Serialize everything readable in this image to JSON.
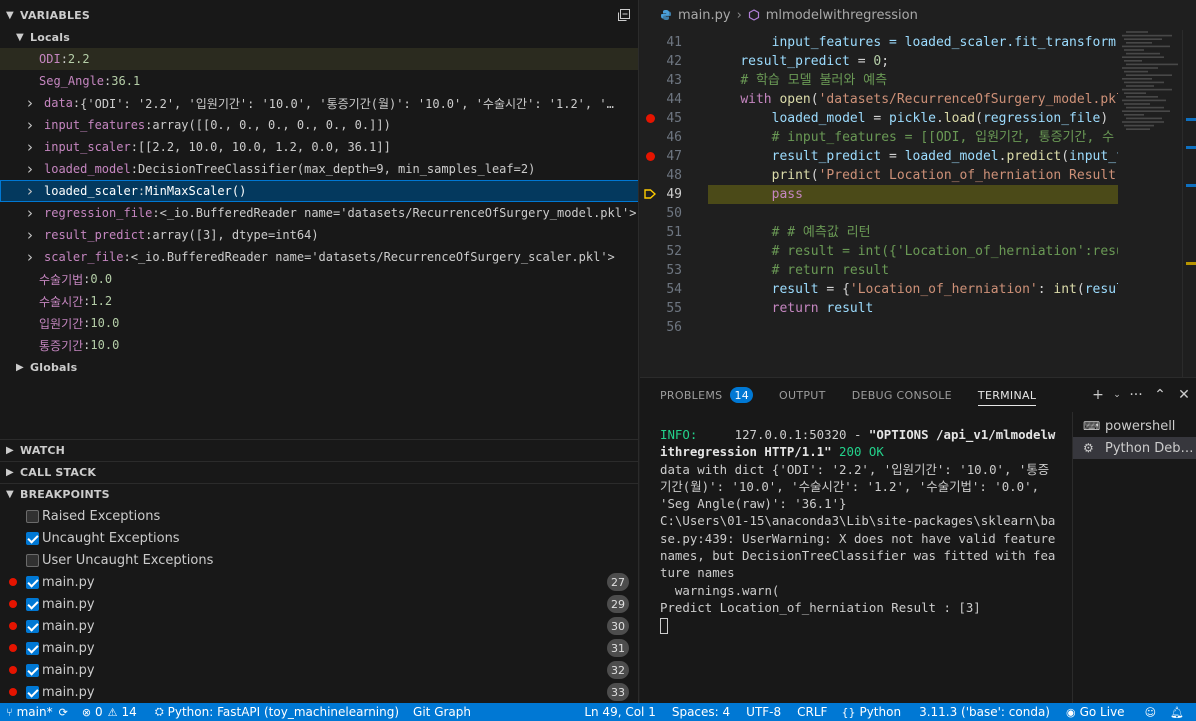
{
  "sidebar": {
    "variables_title": "VARIABLES",
    "locals_title": "Locals",
    "globals_title": "Globals",
    "watch_title": "WATCH",
    "callstack_title": "CALL STACK",
    "breakpoints_title": "BREAKPOINTS",
    "variables": [
      {
        "name": "ODI",
        "value": "2.2",
        "expandable": false,
        "changed": true
      },
      {
        "name": "Seg_Angle",
        "value": "36.1",
        "expandable": false,
        "changed": false
      },
      {
        "name": "data",
        "value": "{'ODI': '2.2', '입원기간': '10.0', '통증기간(월)': '10.0', '수술시간': '1.2', '…",
        "expandable": true
      },
      {
        "name": "input_features",
        "value": "array([[0., 0., 0., 0., 0., 0.]])",
        "expandable": true
      },
      {
        "name": "input_scaler",
        "value": "[[2.2, 10.0, 10.0, 1.2, 0.0, 36.1]]",
        "expandable": true
      },
      {
        "name": "loaded_model",
        "value": "DecisionTreeClassifier(max_depth=9, min_samples_leaf=2)",
        "expandable": true
      },
      {
        "name": "loaded_scaler",
        "value": "MinMaxScaler()",
        "expandable": true,
        "selected": true
      },
      {
        "name": "regression_file",
        "value": "<_io.BufferedReader name='datasets/RecurrenceOfSurgery_model.pkl'>",
        "expandable": true
      },
      {
        "name": "result_predict",
        "value": "array([3], dtype=int64)",
        "expandable": true
      },
      {
        "name": "scaler_file",
        "value": "<_io.BufferedReader name='datasets/RecurrenceOfSurgery_scaler.pkl'>",
        "expandable": true
      },
      {
        "name": "수술기법",
        "value": "0.0",
        "expandable": false
      },
      {
        "name": "수술시간",
        "value": "1.2",
        "expandable": false
      },
      {
        "name": "입원기간",
        "value": "10.0",
        "expandable": false
      },
      {
        "name": "통증기간",
        "value": "10.0",
        "expandable": false
      }
    ],
    "breakpoints": [
      {
        "label": "Raised Exceptions",
        "checked": false,
        "dot": false,
        "count": ""
      },
      {
        "label": "Uncaught Exceptions",
        "checked": true,
        "dot": false,
        "count": ""
      },
      {
        "label": "User Uncaught Exceptions",
        "checked": false,
        "dot": false,
        "count": ""
      },
      {
        "label": "main.py",
        "checked": true,
        "dot": true,
        "count": "27"
      },
      {
        "label": "main.py",
        "checked": true,
        "dot": true,
        "count": "29"
      },
      {
        "label": "main.py",
        "checked": true,
        "dot": true,
        "count": "30"
      },
      {
        "label": "main.py",
        "checked": true,
        "dot": true,
        "count": "31"
      },
      {
        "label": "main.py",
        "checked": true,
        "dot": true,
        "count": "32"
      },
      {
        "label": "main.py",
        "checked": true,
        "dot": true,
        "count": "33"
      }
    ]
  },
  "editor": {
    "file": "main.py",
    "symbol": "mlmodelwithregression",
    "top_partial": "        input_features = loaded_scaler.fit_transform(",
    "lines": [
      {
        "n": "41",
        "text": "",
        "bp": false,
        "current": false
      },
      {
        "n": "42",
        "text": "    result_predict = 0;",
        "bp": false,
        "current": false
      },
      {
        "n": "43",
        "text": "    # 학습 모델 불러와 예측",
        "bp": false,
        "current": false
      },
      {
        "n": "44",
        "text": "    with open('datasets/RecurrenceOfSurgery_model.pkl",
        "bp": false,
        "current": false
      },
      {
        "n": "45",
        "text": "        loaded_model = pickle.load(regression_file)",
        "bp": true,
        "current": false
      },
      {
        "n": "46",
        "text": "        # input_features = [[ODI, 입원기간, 통증기간, 수",
        "bp": false,
        "current": false
      },
      {
        "n": "47",
        "text": "        result_predict = loaded_model.predict(input_fe",
        "bp": true,
        "current": false
      },
      {
        "n": "48",
        "text": "        print('Predict Location_of_herniation Result",
        "bp": false,
        "current": false
      },
      {
        "n": "49",
        "text": "        pass",
        "bp": false,
        "current": true
      },
      {
        "n": "50",
        "text": "",
        "bp": false,
        "current": false
      },
      {
        "n": "51",
        "text": "        # # 예측값 리턴",
        "bp": false,
        "current": false
      },
      {
        "n": "52",
        "text": "        # result = int({'Location_of_herniation':resu",
        "bp": false,
        "current": false
      },
      {
        "n": "53",
        "text": "        # return result",
        "bp": false,
        "current": false
      },
      {
        "n": "54",
        "text": "        result = {'Location_of_herniation': int(result",
        "bp": false,
        "current": false
      },
      {
        "n": "55",
        "text": "        return result",
        "bp": false,
        "current": false
      },
      {
        "n": "56",
        "text": "",
        "bp": false,
        "current": false
      }
    ]
  },
  "panel": {
    "tabs": [
      {
        "label": "PROBLEMS",
        "badge": "14",
        "active": false
      },
      {
        "label": "OUTPUT",
        "badge": "",
        "active": false
      },
      {
        "label": "DEBUG CONSOLE",
        "badge": "",
        "active": false
      },
      {
        "label": "TERMINAL",
        "badge": "",
        "active": true
      }
    ],
    "terminal": {
      "info_label": "INFO:",
      "info_addr": "     127.0.0.1:50320 - ",
      "info_request": "\"OPTIONS /api_v1/mlmodelwithregression HTTP/1.1\"",
      "info_status": " 200 OK",
      "lines": [
        "data with dict {'ODI': '2.2', '입원기간': '10.0', '통증기간(월)': '10.0', '수술시간': '1.2', '수술기법': '0.0', 'Seg Angle(raw)': '36.1'}",
        "C:\\Users\\01-15\\anaconda3\\Lib\\site-packages\\sklearn\\base.py:439: UserWarning: X does not have valid feature names, but DecisionTreeClassifier was fitted with feature names",
        "  warnings.warn(",
        "Predict Location_of_herniation Result : [3]"
      ]
    },
    "terminals": [
      {
        "label": "powershell",
        "icon": "terminal-icon",
        "active": false
      },
      {
        "label": "Python Deb…",
        "icon": "debug-gear-icon",
        "active": true
      }
    ]
  },
  "statusbar": {
    "branch": "main*",
    "errors": "0",
    "warnings": "14",
    "debug_config": "Python: FastAPI (toy_machinelearning)",
    "git_graph": "Git Graph",
    "position": "Ln 49, Col 1",
    "spaces": "Spaces: 4",
    "encoding": "UTF-8",
    "eol": "CRLF",
    "language": "Python",
    "interpreter": "3.11.3 ('base': conda)",
    "golive": "Go Live"
  },
  "colors": {
    "accent": "#0078d4",
    "breakpoint": "#e51400",
    "current_line": "#4b4a18"
  }
}
